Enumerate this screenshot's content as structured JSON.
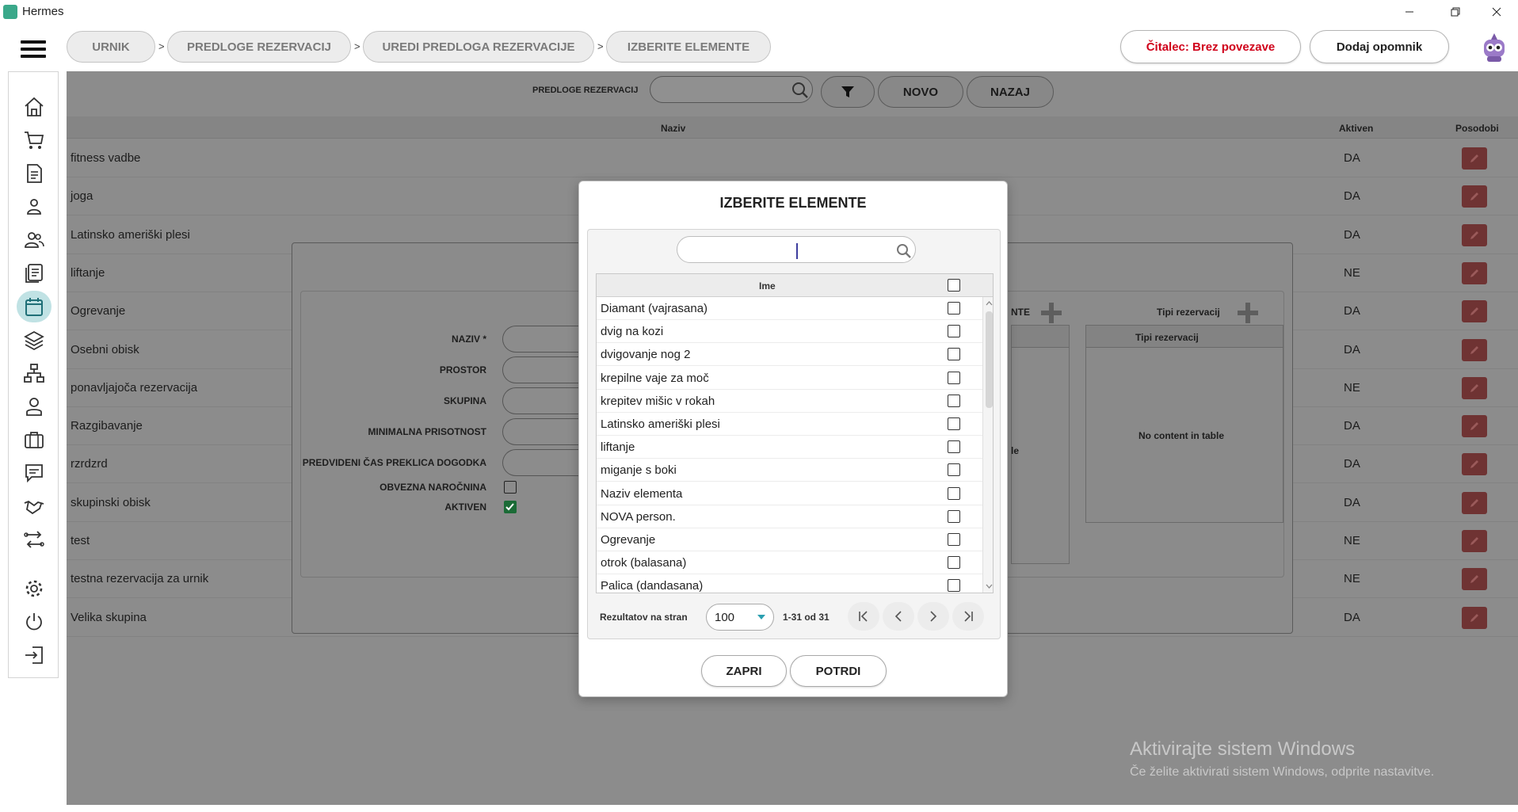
{
  "window": {
    "title": "Hermes"
  },
  "breadcrumbs": [
    "URNIK",
    "PREDLOGE REZERVACIJ",
    "UREDI PREDLOGA REZERVACIJE",
    "IZBERITE ELEMENTE"
  ],
  "breadcrumb_separator": ">",
  "header": {
    "reader_status": "Čitalec: Brez povezave",
    "reader_status_color": "#d0021b",
    "add_reminder": "Dodaj opomnik"
  },
  "sidebar": {
    "icons": [
      "home-icon",
      "cart-icon",
      "document-icon",
      "person-icon",
      "people-icon",
      "list-icon",
      "calendar-icon",
      "layers-icon",
      "network-icon",
      "user-icon",
      "briefcase-icon",
      "chat-icon",
      "handshake-icon",
      "transfer-icon",
      "settings-icon",
      "power-icon",
      "logout-icon"
    ],
    "active": "calendar-icon",
    "active_color": "#c0e2e4"
  },
  "toolbar": {
    "label": "PREDLOGE REZERVACIJ",
    "search_value": "",
    "new_label": "NOVO",
    "back_label": "NAZAJ"
  },
  "table": {
    "columns": {
      "name": "Naziv",
      "active": "Aktiven",
      "update": "Posodobi"
    },
    "rows": [
      {
        "name": "fitness vadbe",
        "active": "DA"
      },
      {
        "name": "joga",
        "active": "DA"
      },
      {
        "name": "Latinsko ameriški plesi",
        "active": "DA"
      },
      {
        "name": "liftanje",
        "active": "NE"
      },
      {
        "name": "Ogrevanje",
        "active": "DA"
      },
      {
        "name": "Osebni obisk",
        "active": "DA"
      },
      {
        "name": "ponavljajoča rezervacija",
        "active": "NE"
      },
      {
        "name": "Razgibavanje",
        "active": "DA"
      },
      {
        "name": "rzrdzrd",
        "active": "DA"
      },
      {
        "name": "skupinski obisk",
        "active": "DA"
      },
      {
        "name": "test",
        "active": "NE"
      },
      {
        "name": "testna rezervacija za urnik",
        "active": "NE"
      },
      {
        "name": "Velika skupina",
        "active": "DA"
      }
    ]
  },
  "edit_form": {
    "labels": [
      "NAZIV *",
      "PROSTOR",
      "SKUPINA",
      "MINIMALNA PRISOTNOST",
      "PREDVIDENI ČAS PREKLICA DOGODKA",
      "OBVEZNA NAROČNINA",
      "AKTIVEN"
    ],
    "mandatory_subscription": false,
    "active": true,
    "elements_label_partial": "NTE",
    "reservation_types_label": "Tipi rezervacij",
    "reservation_types_header": "Tipi rezervacij",
    "reservation_types_empty": "No content in table",
    "partial_text": "le"
  },
  "modal": {
    "title": "IZBERITE ELEMENTE",
    "search_value": "",
    "list_header": "Ime",
    "items": [
      {
        "label": "Diamant (vajrasana)",
        "checked": false
      },
      {
        "label": "dvig na kozi",
        "checked": false
      },
      {
        "label": "dvigovanje nog 2",
        "checked": false
      },
      {
        "label": "krepilne vaje za moč",
        "checked": false
      },
      {
        "label": "krepitev mišic v rokah",
        "checked": false
      },
      {
        "label": "Latinsko ameriški plesi",
        "checked": false
      },
      {
        "label": "liftanje",
        "checked": false
      },
      {
        "label": "miganje s boki",
        "checked": false
      },
      {
        "label": "Naziv elementa",
        "checked": false
      },
      {
        "label": "NOVA person.",
        "checked": false
      },
      {
        "label": "Ogrevanje",
        "checked": false
      },
      {
        "label": "otrok (balasana)",
        "checked": false
      },
      {
        "label": "Palica (dandasana)",
        "checked": false
      }
    ],
    "pager": {
      "results_label": "Rezultatov na stran",
      "page_size": "100",
      "range": "1-31 od 31"
    },
    "close_label": "ZAPRI",
    "confirm_label": "POTRDI"
  },
  "watermark": {
    "title": "Aktivirajte sistem Windows",
    "subtitle": "Če želite aktivirati sistem Windows, odprite nastavitve."
  }
}
